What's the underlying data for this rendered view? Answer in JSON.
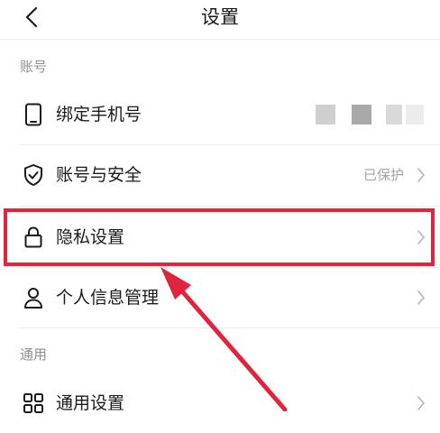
{
  "header": {
    "title": "设置",
    "back_icon": "chevron-left-icon"
  },
  "sections": [
    {
      "label": "账号",
      "items": [
        {
          "label": "绑定手机号",
          "icon": "phone-icon",
          "value": "",
          "masked": true
        },
        {
          "label": "账号与安全",
          "icon": "shield-check-icon",
          "value": "已保护"
        },
        {
          "label": "隐私设置",
          "icon": "lock-icon",
          "value": "",
          "highlighted": true
        },
        {
          "label": "个人信息管理",
          "icon": "user-icon",
          "value": ""
        }
      ]
    },
    {
      "label": "通用",
      "items": [
        {
          "label": "通用设置",
          "icon": "grid-icon",
          "value": ""
        }
      ]
    }
  ],
  "colors": {
    "highlight": "#e0243d",
    "text_primary": "#1a1a1a",
    "text_secondary": "#8f8f8f",
    "divider": "#ededed"
  }
}
